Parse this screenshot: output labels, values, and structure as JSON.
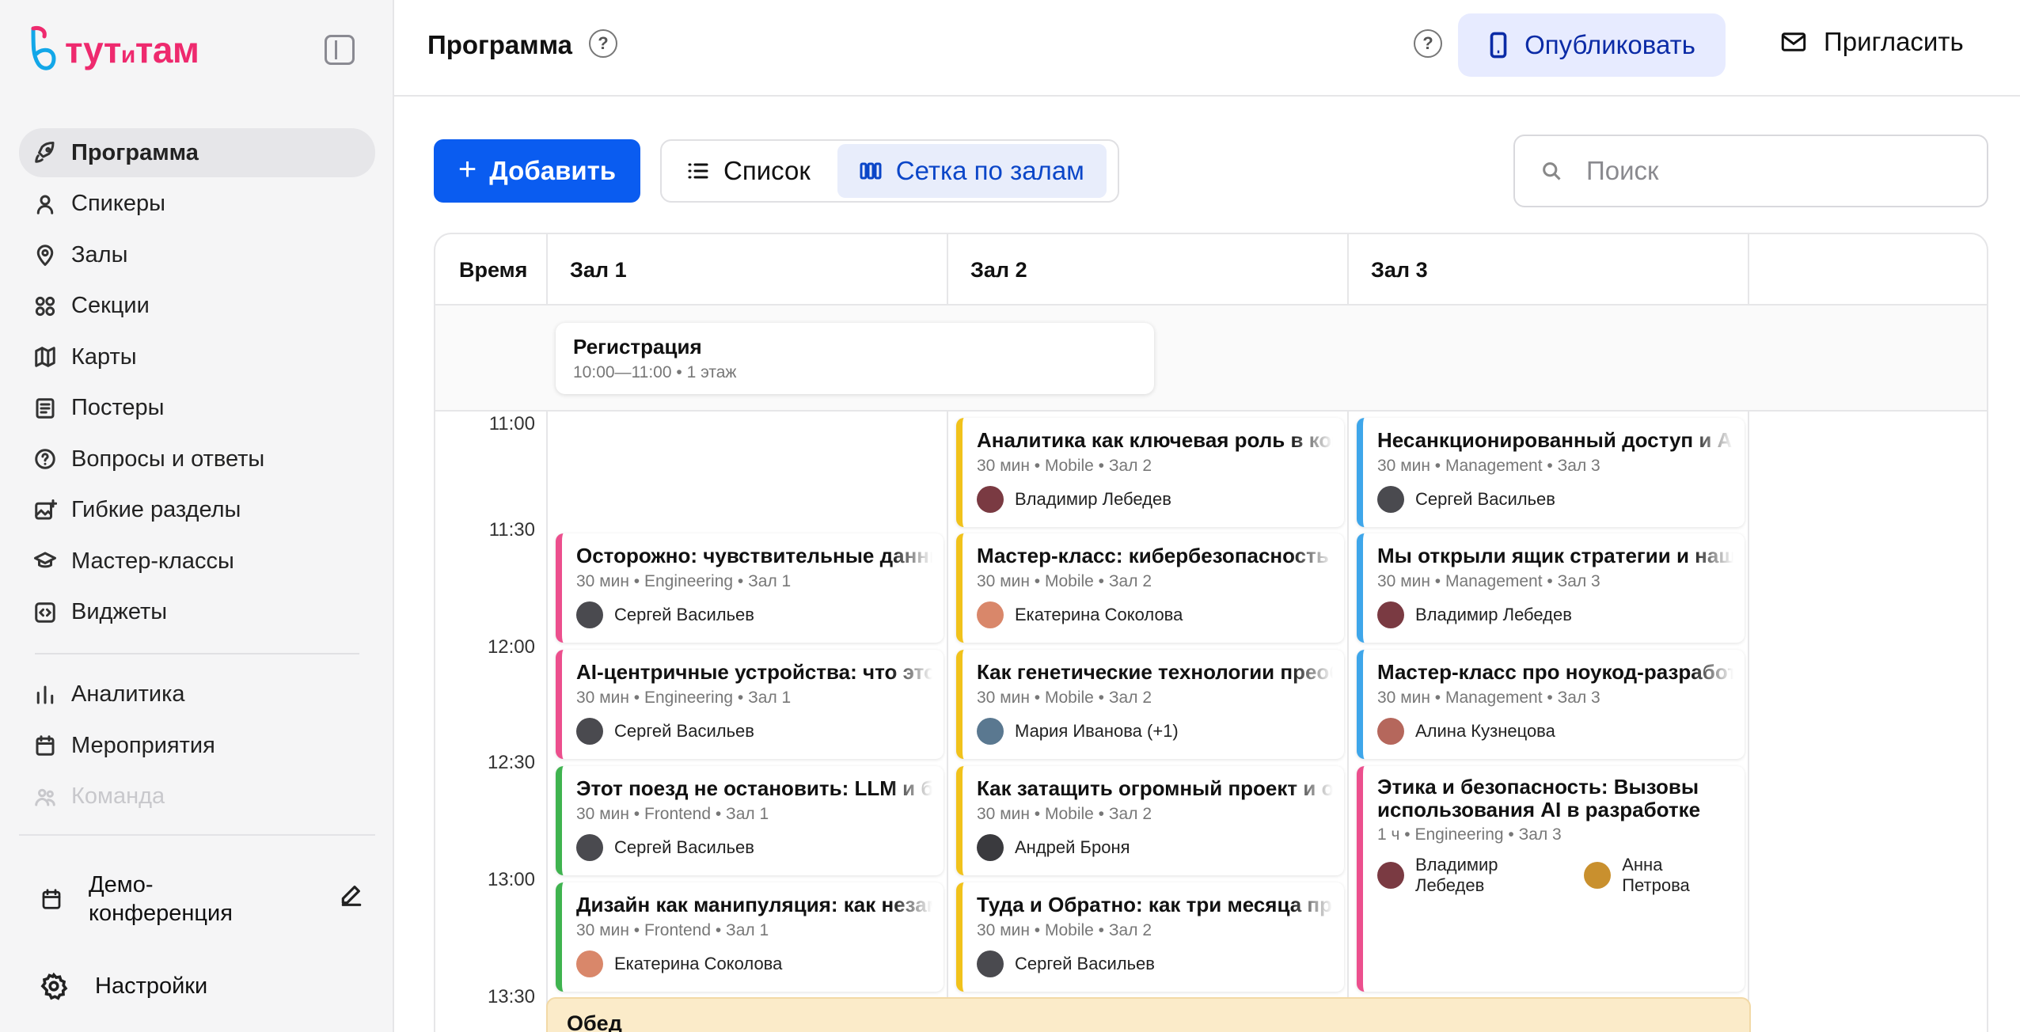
{
  "app": {
    "brand": "тутитам"
  },
  "sidebar": {
    "items": [
      {
        "label": "Программа",
        "icon": "rocket-icon",
        "active": true
      },
      {
        "label": "Спикеры",
        "icon": "user-icon"
      },
      {
        "label": "Залы",
        "icon": "map-pin-icon"
      },
      {
        "label": "Секции",
        "icon": "grid-circles-icon"
      },
      {
        "label": "Карты",
        "icon": "map-icon"
      },
      {
        "label": "Постеры",
        "icon": "poster-icon"
      },
      {
        "label": "Вопросы и ответы",
        "icon": "question-icon"
      },
      {
        "label": "Гибкие разделы",
        "icon": "image-plus-icon"
      },
      {
        "label": "Мастер-классы",
        "icon": "graduation-cap-icon"
      },
      {
        "label": "Виджеты",
        "icon": "code-icon"
      }
    ],
    "secondary": [
      {
        "label": "Аналитика",
        "icon": "bar-chart-icon"
      },
      {
        "label": "Мероприятия",
        "icon": "calendar-icon"
      },
      {
        "label": "Команда",
        "icon": "team-icon"
      }
    ],
    "event_name": "Демо-конференция",
    "settings_label": "Настройки"
  },
  "header": {
    "title": "Программа",
    "help": "?",
    "publish_label": "Опубликовать",
    "invite_label": "Пригласить"
  },
  "toolbar": {
    "add_label": "Добавить",
    "view_list_label": "Список",
    "view_grid_label": "Сетка по залам",
    "search_placeholder": "Поиск"
  },
  "schedule": {
    "time_header": "Время",
    "rooms": [
      "Зал 1",
      "Зал 2",
      "Зал 3"
    ],
    "times": [
      "11:00",
      "11:30",
      "12:00",
      "12:30",
      "13:00",
      "13:30"
    ],
    "registration": {
      "title": "Регистрация",
      "meta": "10:00—11:00 • 1 этаж"
    },
    "lunch": {
      "title": "Обед"
    },
    "sessions": [
      {
        "room": 1,
        "title": "Осторожно: чувствительные данные",
        "meta": "30 мин • Engineering • Зал 1",
        "speakers": [
          "Сергей Васильев"
        ],
        "color": "#ec4f8d"
      },
      {
        "room": 1,
        "title": "AI-центричные устройства: что это",
        "meta": "30 мин • Engineering • Зал 1",
        "speakers": [
          "Сергей Васильев"
        ],
        "color": "#ec4f8d"
      },
      {
        "room": 1,
        "title": "Этот поезд не остановить: LLM и бу",
        "meta": "30 мин • Frontend • Зал 1",
        "speakers": [
          "Сергей Васильев"
        ],
        "color": "#3fb34f"
      },
      {
        "room": 1,
        "title": "Дизайн как манипуляция: как незаметно",
        "meta": "30 мин • Frontend • Зал 1",
        "speakers": [
          "Екатерина Соколова"
        ],
        "color": "#3fb34f"
      },
      {
        "room": 2,
        "title": "Аналитика как ключевая роль в компании",
        "meta": "30 мин • Mobile • Зал 2",
        "speakers": [
          "Владимир Лебедев"
        ],
        "color": "#f1c21b"
      },
      {
        "room": 2,
        "title": "Мастер-класс: кибербезопасность",
        "meta": "30 мин • Mobile • Зал 2",
        "speakers": [
          "Екатерина Соколова"
        ],
        "color": "#f1c21b"
      },
      {
        "room": 2,
        "title": "Как генетические технологии преображают",
        "meta": "30 мин • Mobile • Зал 2",
        "speakers": [
          "Мария Иванова (+1)"
        ],
        "color": "#f1c21b"
      },
      {
        "room": 2,
        "title": "Как затащить огромный проект и остаться",
        "meta": "30 мин • Mobile • Зал 2",
        "speakers": [
          "Андрей Броня"
        ],
        "color": "#f1c21b"
      },
      {
        "room": 2,
        "title": "Туда и Обратно: как три месяца проекта",
        "meta": "30 мин • Mobile • Зал 2",
        "speakers": [
          "Сергей Васильев"
        ],
        "color": "#f1c21b"
      },
      {
        "room": 3,
        "title": "Несанкционированный доступ и AI",
        "meta": "30 мин • Management • Зал 3",
        "speakers": [
          "Сергей Васильев"
        ],
        "color": "#3ea6ea"
      },
      {
        "room": 3,
        "title": "Мы открыли ящик стратегии и нашли",
        "meta": "30 мин • Management • Зал 3",
        "speakers": [
          "Владимир Лебедев"
        ],
        "color": "#3ea6ea"
      },
      {
        "room": 3,
        "title": "Мастер-класс про ноукод-разработку",
        "meta": "30 мин • Management • Зал 3",
        "speakers": [
          "Алина Кузнецова"
        ],
        "color": "#3ea6ea"
      },
      {
        "room": 3,
        "title": "Этика и безопасность: Вызовы использования AI в разработке",
        "meta": "1 ч • Engineering • Зал 3",
        "speakers": [
          "Владимир Лебедев",
          "Анна Петрова"
        ],
        "color": "#ec4f8d"
      }
    ]
  },
  "colors": {
    "accent": "#0a5cf0",
    "brand": "#ee2a6e"
  }
}
